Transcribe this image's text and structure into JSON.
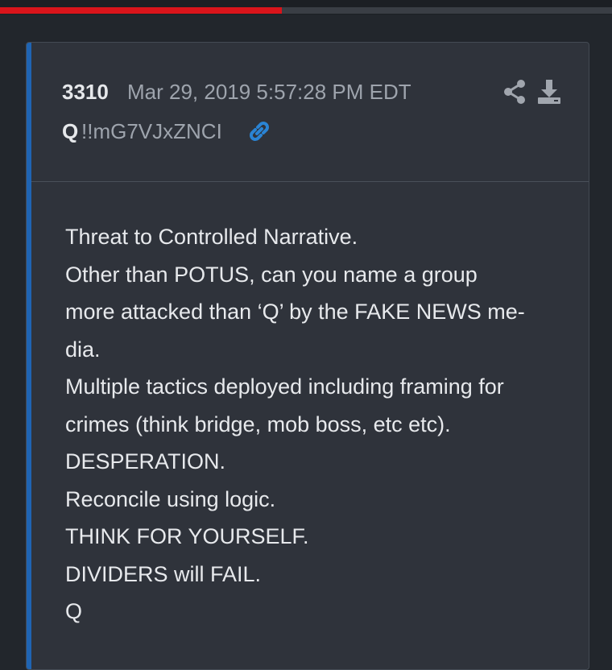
{
  "progress": {
    "fraction": 0.46,
    "fill_color": "#d9141b",
    "track_color": "#3a3e45"
  },
  "post": {
    "number": "3310",
    "timestamp": "Mar 29, 2019 5:57:28 PM EDT",
    "author": "Q",
    "tripcode": "!!mG7VJxZNCI",
    "icons": {
      "share": "share-icon",
      "download": "download-icon",
      "link": "link-icon"
    },
    "accent_color": "#1f64b3",
    "body_lines": [
      "Threat to Controlled Narrative.",
      "Other than POTUS, can you name a group",
      "more attacked than ‘Q’ by the FAKE NEWS me-",
      "dia.",
      "Multiple tactics deployed including framing for",
      "crimes (think bridge, mob boss, etc etc).",
      "DESPERATION.",
      "Reconcile using logic.",
      "THINK FOR YOURSELF.",
      "DIVIDERS will FAIL.",
      "Q"
    ]
  }
}
